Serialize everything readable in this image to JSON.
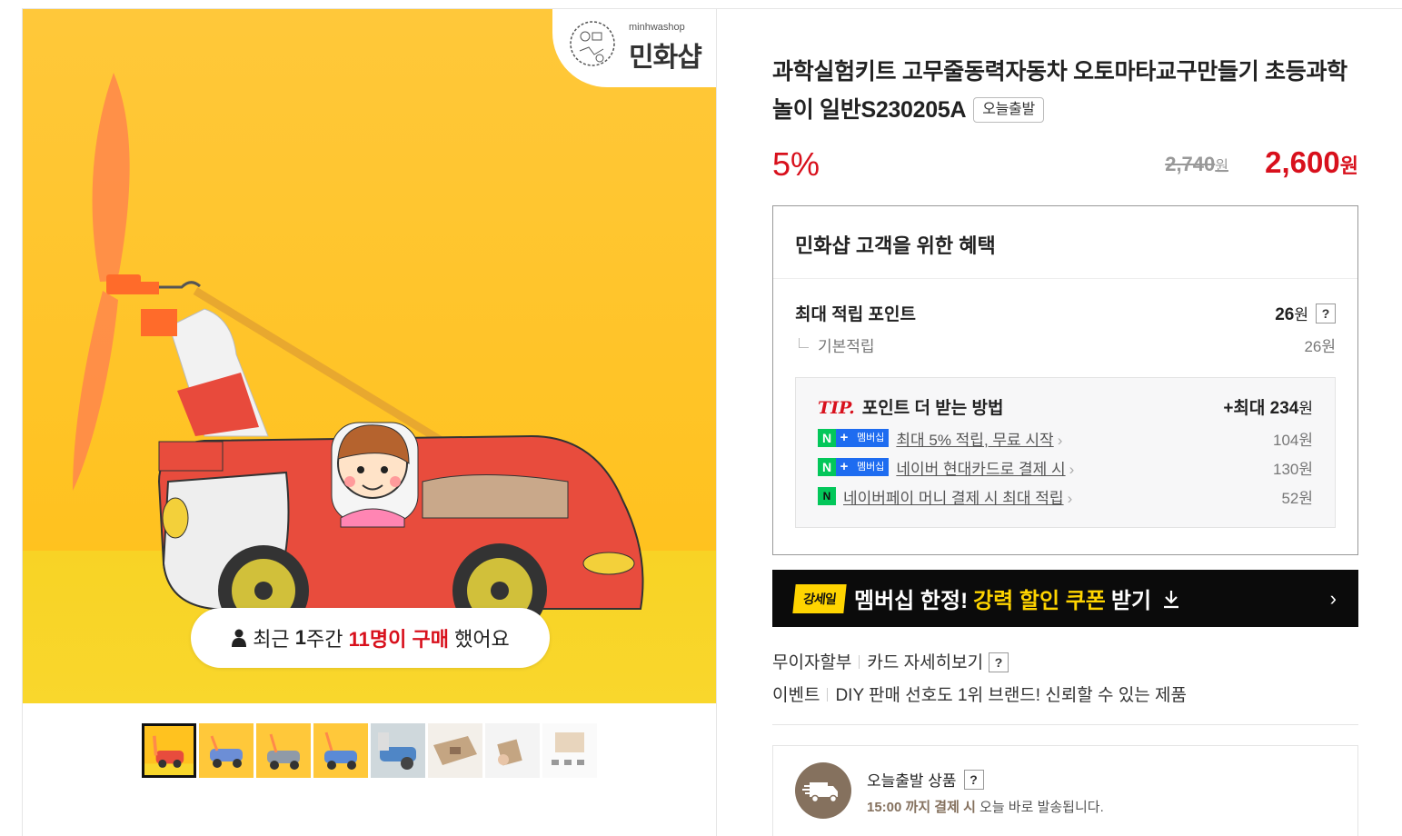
{
  "logo": {
    "small_text": "minhwashop",
    "big_text": "민화샵"
  },
  "purchase_badge": {
    "prefix": "최근 ",
    "week": "1",
    "week_suffix": "주간 ",
    "count": "11명이 구매",
    "suffix": " 했어요"
  },
  "thumbnails": [
    "thumb-1",
    "thumb-2",
    "thumb-3",
    "thumb-4",
    "thumb-5",
    "thumb-6",
    "thumb-7",
    "thumb-8"
  ],
  "product": {
    "title": "과학실험키트 고무줄동력자동차 오토마타교구만들기 초등과학놀이 일반S230205A",
    "today_tag": "오늘출발",
    "discount": "5%",
    "original_price": "2,740",
    "original_unit": "원",
    "sale_price": "2,600",
    "sale_unit": "원"
  },
  "benefit": {
    "heading": "민화샵 고객을 위한 혜택",
    "max_points_label": "최대 적립 포인트",
    "max_points_value": "26",
    "max_points_unit": "원",
    "help": "?",
    "base_label": "기본적립",
    "base_value": "26원",
    "tip": {
      "tip_word": "TIP.",
      "heading": "포인트 더 받는 방법",
      "max_prefix": "+최대 ",
      "max_value": "234",
      "max_unit": "원",
      "membership_badge": "멤버십",
      "rows": [
        {
          "label": "최대 5% 적립, 무료 시작",
          "value": "104원"
        },
        {
          "label": "네이버 현대카드로 결제 시",
          "value": "130원"
        },
        {
          "label": "네이버페이 머니 결제 시 최대 적립",
          "value": "52원"
        }
      ]
    }
  },
  "coupon": {
    "brand": "강세일",
    "text1": "멤버십 한정!",
    "highlight": "강력 할인 쿠폰",
    "text2": "받기",
    "arrow": "›"
  },
  "meta": {
    "installment": "무이자할부",
    "card_detail": "카드 자세히보기",
    "event_label": "이벤트",
    "event_text": "DIY 판매 선호도 1위 브랜드! 신뢰할 수 있는 제품"
  },
  "shipping": {
    "title": "오늘출발 상품",
    "time": "15:00 까지 결제 시",
    "desc": " 오늘 바로 발송됩니다."
  },
  "colors": {
    "accent_red": "#d8101c",
    "naver_green": "#03c75a",
    "coupon_yellow": "#ffd400",
    "ship_brown": "#85715e"
  }
}
